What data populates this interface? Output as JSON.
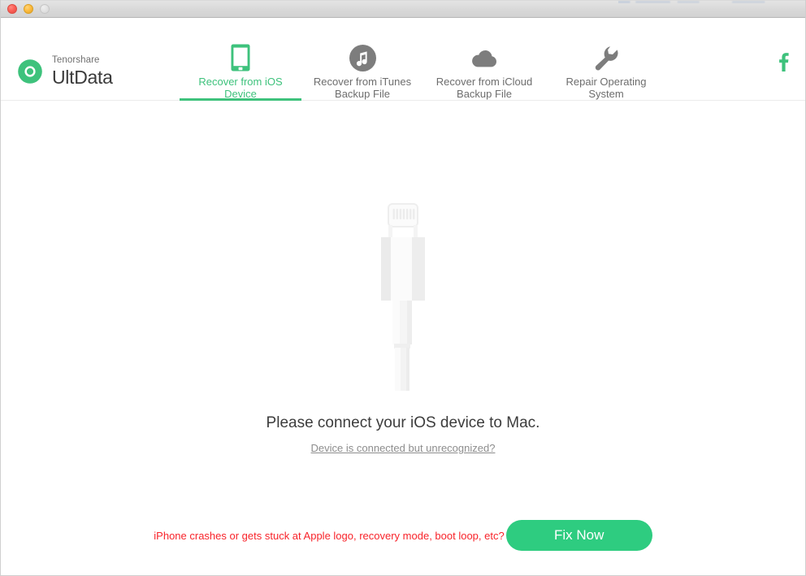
{
  "window": {
    "traffic_lights": [
      {
        "name": "close",
        "color": "#fc6058"
      },
      {
        "name": "minimize",
        "color": "#fdbc40"
      },
      {
        "name": "zoom",
        "color": "#e3e3e3"
      }
    ]
  },
  "brand": {
    "company": "Tenorshare",
    "product": "UltData",
    "logo_icon": "circular-arrow-logo-icon",
    "accent_color": "#3ec27c"
  },
  "nav": {
    "tabs": [
      {
        "id": "ios-device",
        "label": "Recover from iOS Device",
        "line1": "Recover from iOS",
        "line2": "Device",
        "icon": "iphone-icon",
        "active": true
      },
      {
        "id": "itunes-backup",
        "label": "Recover from iTunes Backup File",
        "line1": "Recover from iTunes",
        "line2": "Backup File",
        "icon": "itunes-music-note-icon",
        "active": false
      },
      {
        "id": "icloud-backup",
        "label": "Recover from iCloud Backup File",
        "line1": "Recover from iCloud",
        "line2": "Backup File",
        "icon": "cloud-icon",
        "active": false
      },
      {
        "id": "repair-os",
        "label": "Repair Operating System",
        "line1": "Repair Operating",
        "line2": "System",
        "icon": "wrench-icon",
        "active": false
      }
    ],
    "social": {
      "icon": "facebook-icon",
      "label": "f",
      "color": "#3ec27c"
    }
  },
  "main": {
    "illustration": "lightning-cable-connector-illustration",
    "headline": "Please connect your iOS device to Mac.",
    "help_link": "Device is connected but unrecognized?"
  },
  "footer": {
    "crash_note": "iPhone crashes or gets stuck at Apple logo, recovery mode, boot loop, etc?",
    "crash_note_color": "#f8232a",
    "fix_button_label": "Fix Now",
    "fix_button_color": "#2ecc80"
  }
}
